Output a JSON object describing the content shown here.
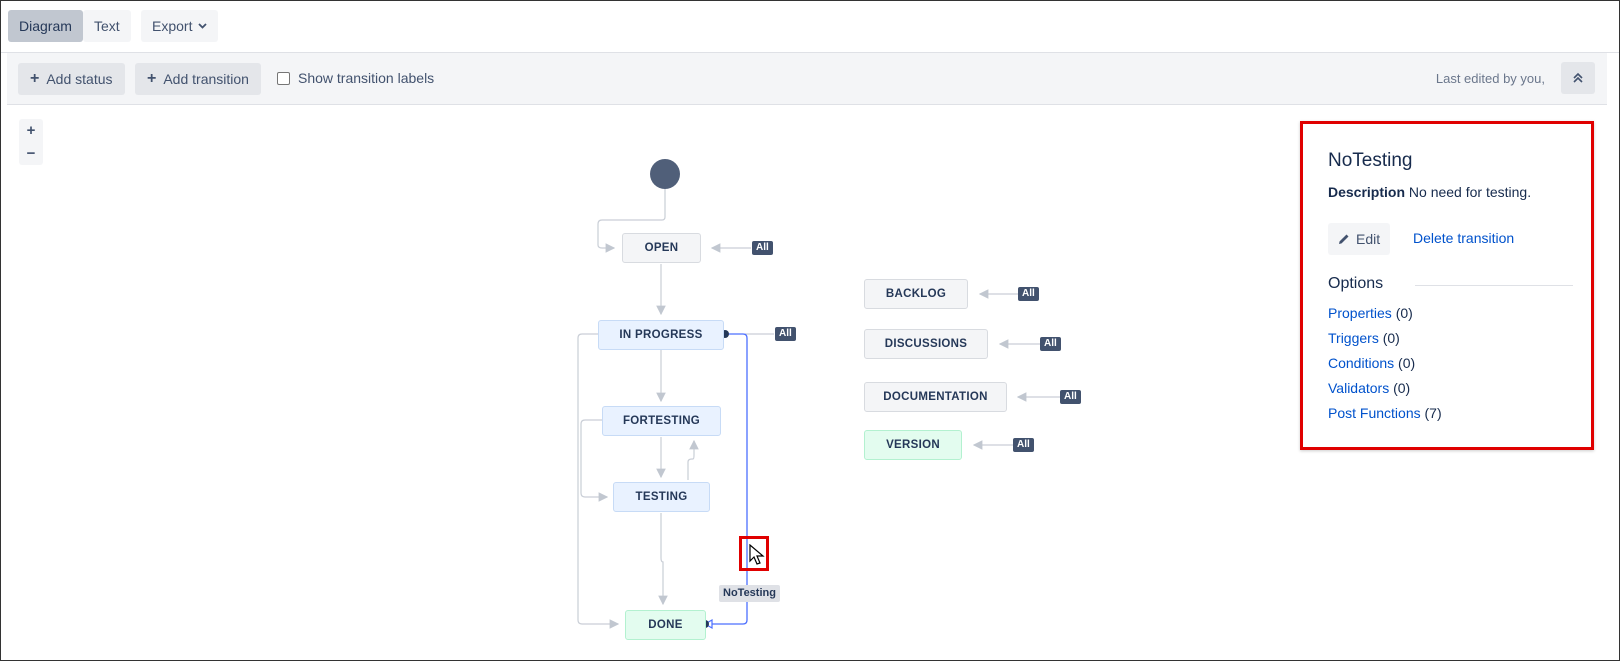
{
  "tabs": {
    "diagram": "Diagram",
    "text": "Text",
    "export": "Export"
  },
  "toolbar": {
    "add_status": "Add status",
    "add_transition": "Add transition",
    "show_labels": "Show transition labels",
    "last_edited": "Last edited by you,"
  },
  "zoom": {
    "in": "+",
    "out": "−"
  },
  "statuses": {
    "open": "OPEN",
    "in_progress": "IN PROGRESS",
    "fortesting": "FORTESTING",
    "testing": "TESTING",
    "done": "DONE",
    "backlog": "BACKLOG",
    "discussions": "DISCUSSIONS",
    "documentation": "DOCUMENTATION",
    "version": "VERSION"
  },
  "all_badge": "All",
  "transition_label": "NoTesting",
  "panel": {
    "title": "NoTesting",
    "description_label": "Description",
    "description_value": "No need for testing.",
    "edit": "Edit",
    "delete": "Delete transition",
    "options_title": "Options",
    "options": [
      {
        "label": "Properties",
        "count": "(0)"
      },
      {
        "label": "Triggers",
        "count": "(0)"
      },
      {
        "label": "Conditions",
        "count": "(0)"
      },
      {
        "label": "Validators",
        "count": "(0)"
      },
      {
        "label": "Post Functions",
        "count": "(7)"
      }
    ]
  },
  "colors": {
    "highlight": "#e00000",
    "selected_transition": "#4c6fff",
    "badge": "#42526e",
    "link": "#0052cc"
  }
}
